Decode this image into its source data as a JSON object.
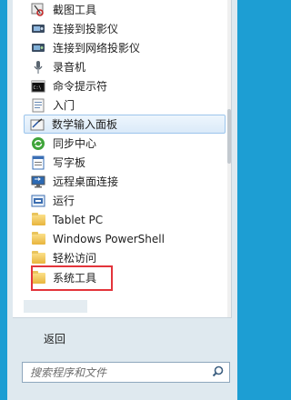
{
  "menu": {
    "items": [
      {
        "label": "截图工具",
        "icon": "scissors-icon"
      },
      {
        "label": "连接到投影仪",
        "icon": "projector-icon"
      },
      {
        "label": "连接到网络投影仪",
        "icon": "network-projector-icon"
      },
      {
        "label": "录音机",
        "icon": "microphone-icon"
      },
      {
        "label": "命令提示符",
        "icon": "command-prompt-icon"
      },
      {
        "label": "入门",
        "icon": "getting-started-icon"
      },
      {
        "label": "数学输入面板",
        "icon": "math-input-icon"
      },
      {
        "label": "同步中心",
        "icon": "sync-icon"
      },
      {
        "label": "写字板",
        "icon": "wordpad-icon"
      },
      {
        "label": "远程桌面连接",
        "icon": "remote-desktop-icon"
      },
      {
        "label": "运行",
        "icon": "run-icon"
      },
      {
        "label": "Tablet PC",
        "icon": "folder-icon"
      },
      {
        "label": "Windows PowerShell",
        "icon": "folder-icon"
      },
      {
        "label": "轻松访问",
        "icon": "folder-icon"
      },
      {
        "label": "系统工具",
        "icon": "folder-icon"
      }
    ],
    "highlighted_item": "数学输入面板",
    "back_label": "返回"
  },
  "search": {
    "placeholder": "搜索程序和文件",
    "icon": "search-icon"
  },
  "colors": {
    "highlight_border": "#9cc5ec",
    "annotation_box": "#e3343b",
    "folder": "#e8b43c"
  }
}
